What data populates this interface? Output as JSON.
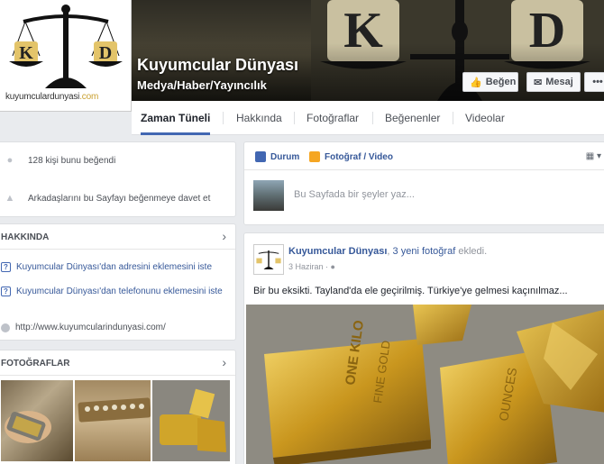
{
  "page": {
    "name": "Kuyumcular Dünyası",
    "category": "Medya/Haber/Yayıncılık",
    "site_text": "kuyumculardunyasi",
    "site_tld": ".com"
  },
  "cover_buttons": {
    "like": "Beğen",
    "message": "Mesaj",
    "more": "•••"
  },
  "tabs": [
    "Zaman Tüneli",
    "Hakkında",
    "Fotoğraflar",
    "Beğenenler",
    "Videolar"
  ],
  "likes": {
    "count_text": "128 kişi bunu beğendi",
    "invite_text": "Arkadaşlarını bu Sayfayı beğenmeye davet et"
  },
  "about": {
    "title": "HAKKINDA",
    "address_prompt": "Kuyumcular Dünyası'dan adresini eklemesini iste",
    "phone_prompt": "Kuyumcular Dünyası'dan telefonunu eklemesini iste",
    "url": "http://www.kuyumcularindunyasi.com/"
  },
  "photos": {
    "title": "FOTOĞRAFLAR"
  },
  "composer": {
    "status_tab": "Durum",
    "photo_tab": "Fotoğraf / Video",
    "placeholder": "Bu Sayfada bir şeyler yaz..."
  },
  "post": {
    "author": "Kuyumcular Dünyası",
    "action_sep": ", ",
    "action_link": "3 yeni fotoğraf",
    "action_rest": " ekledi.",
    "date": "3 Haziran · ",
    "text": "Bir bu eksikti. Tayland'da ele geçirilmiş. Türkiye'ye gelmesi kaçınılmaz..."
  },
  "colors": {
    "accent": "#4267b2",
    "link": "#365899",
    "gold": "#c9a030"
  }
}
